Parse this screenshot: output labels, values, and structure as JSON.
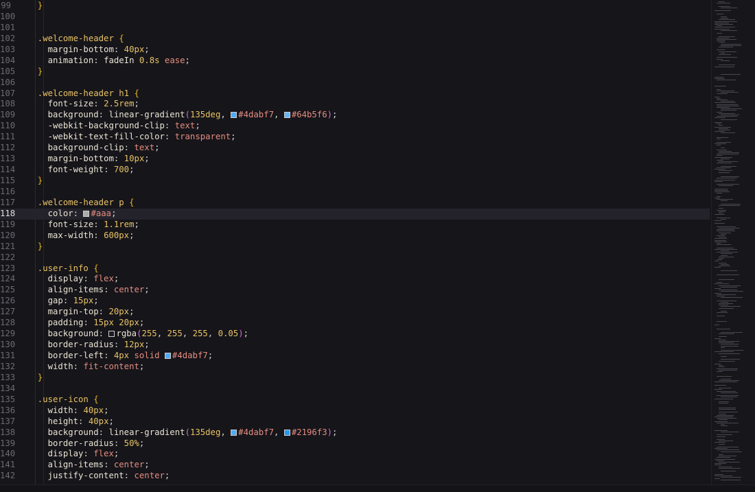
{
  "editor": {
    "active_line": 118,
    "lines": [
      {
        "n": 99,
        "tokens": [
          [
            "brace",
            "  }"
          ]
        ]
      },
      {
        "n": 100,
        "tokens": []
      },
      {
        "n": 101,
        "tokens": []
      },
      {
        "n": 102,
        "tokens": [
          [
            "sel",
            "  .welcome-header "
          ],
          [
            "brace",
            "{"
          ]
        ]
      },
      {
        "n": 103,
        "tokens": [
          [
            "prop",
            "    margin-bottom"
          ],
          [
            "punct",
            ": "
          ],
          [
            "num",
            "40px"
          ],
          [
            "punct",
            ";"
          ]
        ]
      },
      {
        "n": 104,
        "tokens": [
          [
            "prop",
            "    animation"
          ],
          [
            "punct",
            ": "
          ],
          [
            "fn",
            "fadeIn "
          ],
          [
            "num",
            "0.8s "
          ],
          [
            "kw",
            "ease"
          ],
          [
            "punct",
            ";"
          ]
        ]
      },
      {
        "n": 105,
        "tokens": [
          [
            "brace",
            "  }"
          ]
        ]
      },
      {
        "n": 106,
        "tokens": []
      },
      {
        "n": 107,
        "tokens": [
          [
            "sel",
            "  .welcome-header h1 "
          ],
          [
            "brace",
            "{"
          ]
        ]
      },
      {
        "n": 108,
        "tokens": [
          [
            "prop",
            "    font-size"
          ],
          [
            "punct",
            ": "
          ],
          [
            "num",
            "2.5rem"
          ],
          [
            "punct",
            ";"
          ]
        ]
      },
      {
        "n": 109,
        "tokens": [
          [
            "prop",
            "    background"
          ],
          [
            "punct",
            ": "
          ],
          [
            "fn",
            "linear-gradient"
          ],
          [
            "paren",
            "("
          ],
          [
            "num",
            "135deg"
          ],
          [
            "punct",
            ", "
          ],
          [
            "swatch",
            "#4dabf7"
          ],
          [
            "hex",
            "#4dabf7"
          ],
          [
            "punct",
            ", "
          ],
          [
            "swatch",
            "#64b5f6"
          ],
          [
            "hex",
            "#64b5f6"
          ],
          [
            "paren",
            ")"
          ],
          [
            "punct",
            ";"
          ]
        ]
      },
      {
        "n": 110,
        "tokens": [
          [
            "prop",
            "    -webkit-background-clip"
          ],
          [
            "punct",
            ": "
          ],
          [
            "kw",
            "text"
          ],
          [
            "punct",
            ";"
          ]
        ]
      },
      {
        "n": 111,
        "tokens": [
          [
            "prop",
            "    -webkit-text-fill-color"
          ],
          [
            "punct",
            ": "
          ],
          [
            "kw",
            "transparent"
          ],
          [
            "punct",
            ";"
          ]
        ]
      },
      {
        "n": 112,
        "tokens": [
          [
            "prop",
            "    background-clip"
          ],
          [
            "punct",
            ": "
          ],
          [
            "kw",
            "text"
          ],
          [
            "punct",
            ";"
          ]
        ]
      },
      {
        "n": 113,
        "tokens": [
          [
            "prop",
            "    margin-bottom"
          ],
          [
            "punct",
            ": "
          ],
          [
            "num",
            "10px"
          ],
          [
            "punct",
            ";"
          ]
        ]
      },
      {
        "n": 114,
        "tokens": [
          [
            "prop",
            "    font-weight"
          ],
          [
            "punct",
            ": "
          ],
          [
            "num",
            "700"
          ],
          [
            "punct",
            ";"
          ]
        ]
      },
      {
        "n": 115,
        "tokens": [
          [
            "brace",
            "  }"
          ]
        ]
      },
      {
        "n": 116,
        "tokens": []
      },
      {
        "n": 117,
        "tokens": [
          [
            "sel",
            "  .welcome-header p "
          ],
          [
            "brace",
            "{"
          ]
        ]
      },
      {
        "n": 118,
        "tokens": [
          [
            "prop",
            "    color"
          ],
          [
            "punct",
            ": "
          ],
          [
            "swatch",
            "#aaaaaa"
          ],
          [
            "hex",
            "#aaa"
          ],
          [
            "punct",
            ";"
          ]
        ]
      },
      {
        "n": 119,
        "tokens": [
          [
            "prop",
            "    font-size"
          ],
          [
            "punct",
            ": "
          ],
          [
            "num",
            "1.1rem"
          ],
          [
            "punct",
            ";"
          ]
        ]
      },
      {
        "n": 120,
        "tokens": [
          [
            "prop",
            "    max-width"
          ],
          [
            "punct",
            ": "
          ],
          [
            "num",
            "600px"
          ],
          [
            "punct",
            ";"
          ]
        ]
      },
      {
        "n": 121,
        "tokens": [
          [
            "brace",
            "  }"
          ]
        ]
      },
      {
        "n": 122,
        "tokens": []
      },
      {
        "n": 123,
        "tokens": [
          [
            "sel",
            "  .user-info "
          ],
          [
            "brace",
            "{"
          ]
        ]
      },
      {
        "n": 124,
        "tokens": [
          [
            "prop",
            "    display"
          ],
          [
            "punct",
            ": "
          ],
          [
            "kw",
            "flex"
          ],
          [
            "punct",
            ";"
          ]
        ]
      },
      {
        "n": 125,
        "tokens": [
          [
            "prop",
            "    align-items"
          ],
          [
            "punct",
            ": "
          ],
          [
            "kw",
            "center"
          ],
          [
            "punct",
            ";"
          ]
        ]
      },
      {
        "n": 126,
        "tokens": [
          [
            "prop",
            "    gap"
          ],
          [
            "punct",
            ": "
          ],
          [
            "num",
            "15px"
          ],
          [
            "punct",
            ";"
          ]
        ]
      },
      {
        "n": 127,
        "tokens": [
          [
            "prop",
            "    margin-top"
          ],
          [
            "punct",
            ": "
          ],
          [
            "num",
            "20px"
          ],
          [
            "punct",
            ";"
          ]
        ]
      },
      {
        "n": 128,
        "tokens": [
          [
            "prop",
            "    padding"
          ],
          [
            "punct",
            ": "
          ],
          [
            "num",
            "15px 20px"
          ],
          [
            "punct",
            ";"
          ]
        ]
      },
      {
        "n": 129,
        "tokens": [
          [
            "prop",
            "    background"
          ],
          [
            "punct",
            ": "
          ],
          [
            "swatch",
            "#1c1b20"
          ],
          [
            "fn",
            "rgba"
          ],
          [
            "paren",
            "("
          ],
          [
            "num",
            "255"
          ],
          [
            "punct",
            ", "
          ],
          [
            "num",
            "255"
          ],
          [
            "punct",
            ", "
          ],
          [
            "num",
            "255"
          ],
          [
            "punct",
            ", "
          ],
          [
            "num",
            "0.05"
          ],
          [
            "paren",
            ")"
          ],
          [
            "punct",
            ";"
          ]
        ]
      },
      {
        "n": 130,
        "tokens": [
          [
            "prop",
            "    border-radius"
          ],
          [
            "punct",
            ": "
          ],
          [
            "num",
            "12px"
          ],
          [
            "punct",
            ";"
          ]
        ]
      },
      {
        "n": 131,
        "tokens": [
          [
            "prop",
            "    border-left"
          ],
          [
            "punct",
            ": "
          ],
          [
            "num",
            "4px "
          ],
          [
            "kw",
            "solid "
          ],
          [
            "swatch",
            "#4dabf7"
          ],
          [
            "hex",
            "#4dabf7"
          ],
          [
            "punct",
            ";"
          ]
        ]
      },
      {
        "n": 132,
        "tokens": [
          [
            "prop",
            "    width"
          ],
          [
            "punct",
            ": "
          ],
          [
            "kw",
            "fit-content"
          ],
          [
            "punct",
            ";"
          ]
        ]
      },
      {
        "n": 133,
        "tokens": [
          [
            "brace",
            "  }"
          ]
        ]
      },
      {
        "n": 134,
        "tokens": []
      },
      {
        "n": 135,
        "tokens": [
          [
            "sel",
            "  .user-icon "
          ],
          [
            "brace",
            "{"
          ]
        ]
      },
      {
        "n": 136,
        "tokens": [
          [
            "prop",
            "    width"
          ],
          [
            "punct",
            ": "
          ],
          [
            "num",
            "40px"
          ],
          [
            "punct",
            ";"
          ]
        ]
      },
      {
        "n": 137,
        "tokens": [
          [
            "prop",
            "    height"
          ],
          [
            "punct",
            ": "
          ],
          [
            "num",
            "40px"
          ],
          [
            "punct",
            ";"
          ]
        ]
      },
      {
        "n": 138,
        "tokens": [
          [
            "prop",
            "    background"
          ],
          [
            "punct",
            ": "
          ],
          [
            "fn",
            "linear-gradient"
          ],
          [
            "paren",
            "("
          ],
          [
            "num",
            "135deg"
          ],
          [
            "punct",
            ", "
          ],
          [
            "swatch",
            "#4dabf7"
          ],
          [
            "hex",
            "#4dabf7"
          ],
          [
            "punct",
            ", "
          ],
          [
            "swatch",
            "#2196f3"
          ],
          [
            "hex",
            "#2196f3"
          ],
          [
            "paren",
            ")"
          ],
          [
            "punct",
            ";"
          ]
        ]
      },
      {
        "n": 139,
        "tokens": [
          [
            "prop",
            "    border-radius"
          ],
          [
            "punct",
            ": "
          ],
          [
            "num",
            "50%"
          ],
          [
            "punct",
            ";"
          ]
        ]
      },
      {
        "n": 140,
        "tokens": [
          [
            "prop",
            "    display"
          ],
          [
            "punct",
            ": "
          ],
          [
            "kw",
            "flex"
          ],
          [
            "punct",
            ";"
          ]
        ]
      },
      {
        "n": 141,
        "tokens": [
          [
            "prop",
            "    align-items"
          ],
          [
            "punct",
            ": "
          ],
          [
            "kw",
            "center"
          ],
          [
            "punct",
            ";"
          ]
        ]
      },
      {
        "n": 142,
        "tokens": [
          [
            "prop",
            "    justify-content"
          ],
          [
            "punct",
            ": "
          ],
          [
            "kw",
            "center"
          ],
          [
            "punct",
            ";"
          ]
        ]
      }
    ]
  }
}
